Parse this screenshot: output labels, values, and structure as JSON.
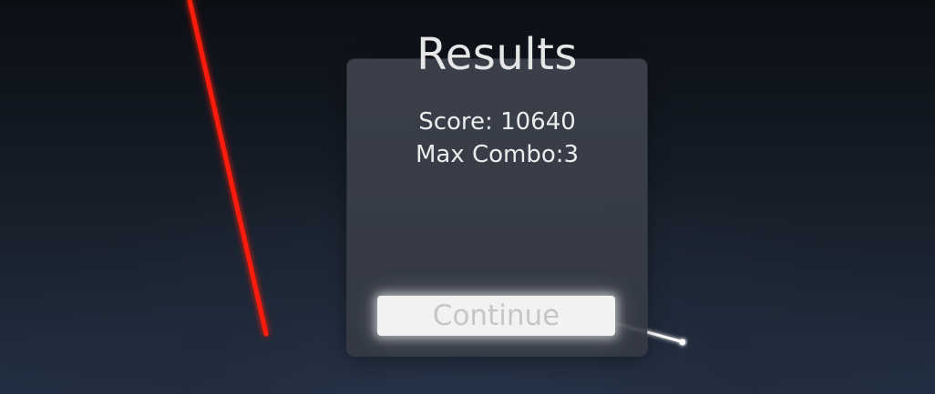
{
  "results_panel": {
    "title": "Results",
    "score_text": "Score: 10640",
    "max_combo_text": "Max Combo:3",
    "continue_label": "Continue"
  },
  "colors": {
    "left_laser": "#ff1a10",
    "right_pointer": "#ffffff",
    "panel_bg": "#3a3f4a",
    "button_bg": "#f2f2f2"
  }
}
